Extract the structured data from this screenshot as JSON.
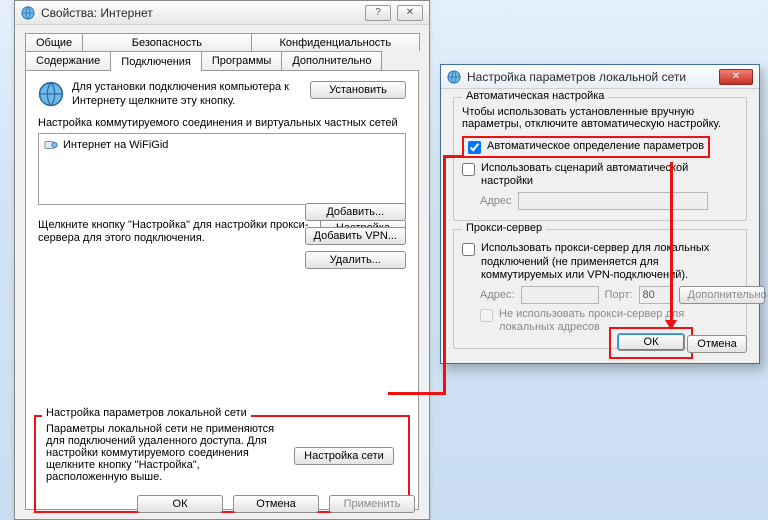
{
  "main_dialog": {
    "title": "Свойства: Интернет",
    "tabs_row1": [
      "Общие",
      "Безопасность",
      "Конфиденциальность"
    ],
    "tabs_row2": [
      "Содержание",
      "Подключения",
      "Программы",
      "Дополнительно"
    ],
    "active_tab": "Подключения",
    "setup": {
      "text": "Для установки подключения компьютера к Интернету щелкните эту кнопку.",
      "button": "Установить"
    },
    "dialup_label": "Настройка коммутируемого соединения и виртуальных частных сетей",
    "connection_item": "Интернет на WiFiGid",
    "buttons": {
      "add": "Добавить...",
      "add_vpn": "Добавить VPN...",
      "remove": "Удалить...",
      "settings": "Настройка"
    },
    "settings_hint": "Щелкните кнопку \"Настройка\" для настройки прокси-сервера для этого подключения.",
    "lan": {
      "heading": "Настройка параметров локальной сети",
      "text": "Параметры локальной сети не применяются для подключений удаленного доступа. Для настройки коммутируемого соединения щелкните кнопку \"Настройка\", расположенную выше.",
      "button": "Настройка сети"
    },
    "footer": {
      "ok": "ОК",
      "cancel": "Отмена",
      "apply": "Применить"
    }
  },
  "lan_dialog": {
    "title": "Настройка параметров локальной сети",
    "auto": {
      "legend": "Автоматическая настройка",
      "note": "Чтобы использовать установленные вручную параметры, отключите автоматическую настройку.",
      "auto_detect": "Автоматическое определение параметров",
      "use_script": "Использовать сценарий автоматической настройки",
      "address_label": "Адрес",
      "address_value": ""
    },
    "proxy": {
      "legend": "Прокси-сервер",
      "use_proxy": "Использовать прокси-сервер для локальных подключений (не применяется для коммутируемых или VPN-подключений).",
      "address_label": "Адрес:",
      "address_value": "",
      "port_label": "Порт:",
      "port_value": "80",
      "advanced": "Дополнительно",
      "bypass_local": "Не использовать прокси-сервер для локальных адресов"
    },
    "ok": "ОК",
    "cancel": "Отмена"
  }
}
